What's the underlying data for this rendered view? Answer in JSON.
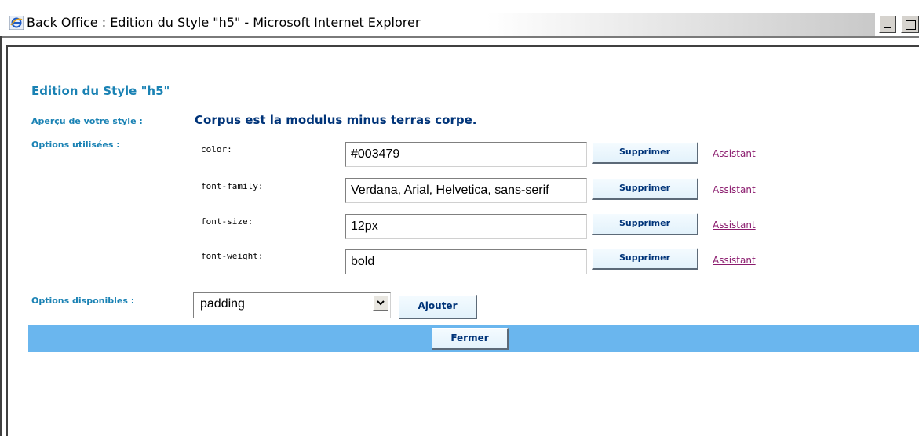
{
  "window": {
    "title": "Back Office : Edition du Style \"h5\" - Microsoft Internet Explorer"
  },
  "page": {
    "title": "Edition du Style \"h5\"",
    "preview_label": "Aperçu de votre style :",
    "preview_text": "Corpus est la modulus minus terras corpe.",
    "preview_color": "#003479",
    "options_used_label": "Options utilisées :",
    "options_available_label": "Options disponibles :"
  },
  "options_used": [
    {
      "name": "color:",
      "value": "#003479",
      "remove_label": "Supprimer",
      "assistant_label": "Assistant"
    },
    {
      "name": "font-family:",
      "value": "Verdana, Arial, Helvetica, sans-serif",
      "remove_label": "Supprimer",
      "assistant_label": "Assistant"
    },
    {
      "name": "font-size:",
      "value": "12px",
      "remove_label": "Supprimer",
      "assistant_label": "Assistant"
    },
    {
      "name": "font-weight:",
      "value": "bold",
      "remove_label": "Supprimer",
      "assistant_label": "Assistant"
    }
  ],
  "options_available": {
    "selected": "padding",
    "add_label": "Ajouter"
  },
  "footer": {
    "close_label": "Fermer"
  },
  "colors": {
    "accent_blue": "#1a82b4",
    "footer_bar": "#6ab6ee",
    "link_visited": "#8b1c6e"
  }
}
